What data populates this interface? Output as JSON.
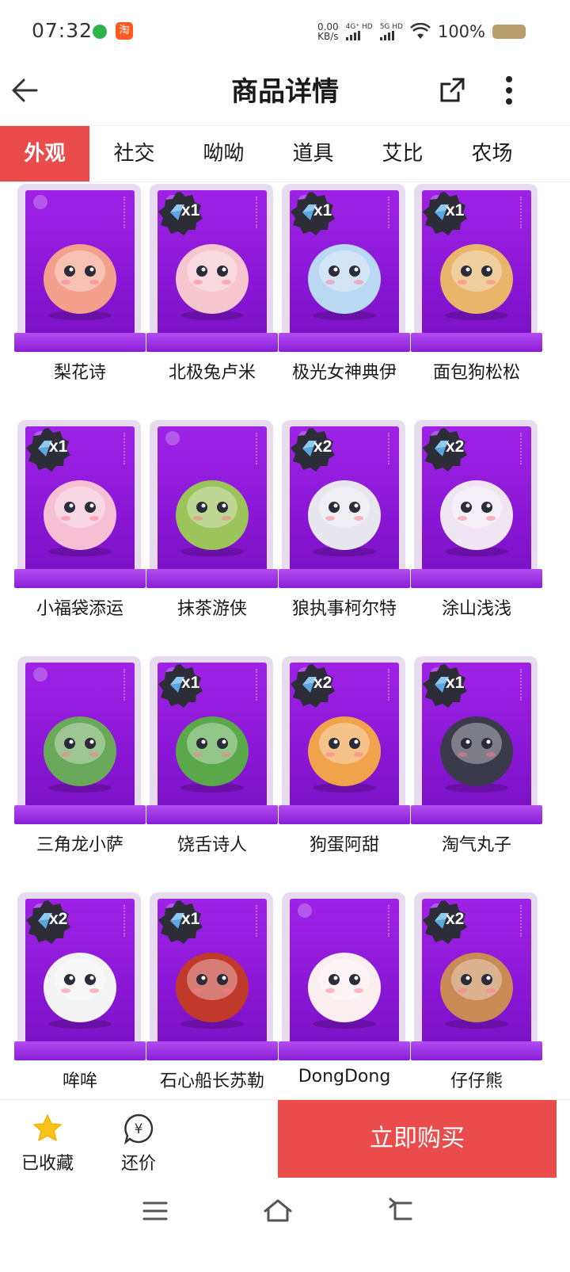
{
  "status_bar": {
    "time": "07:32",
    "net_speed_value": "0.00",
    "net_speed_unit": "KB/s",
    "sim1_label": "4G⁺ HD",
    "sim2_label": "5G HD",
    "battery_pct": "100%",
    "app_icon_text": "淘"
  },
  "nav": {
    "title": "商品详情",
    "back_icon": "arrow-left-icon",
    "share_icon": "share-icon",
    "more_icon": "more-vertical-icon"
  },
  "tabs": [
    {
      "label": "外观",
      "active": true
    },
    {
      "label": "社交",
      "active": false
    },
    {
      "label": "呦呦",
      "active": false
    },
    {
      "label": "道具",
      "active": false
    },
    {
      "label": "艾比",
      "active": false
    },
    {
      "label": "农场",
      "active": false
    }
  ],
  "items": [
    {
      "name": "梨花诗",
      "badge": "",
      "color": "#f3a08c"
    },
    {
      "name": "北极兔卢米",
      "badge": "x1",
      "color": "#f6c6cf"
    },
    {
      "name": "极光女神典伊",
      "badge": "x1",
      "color": "#b9d8f3"
    },
    {
      "name": "面包狗松松",
      "badge": "x1",
      "color": "#e9b56a"
    },
    {
      "name": "小福袋添运",
      "badge": "x1",
      "color": "#f5c0d4"
    },
    {
      "name": "抹茶游侠",
      "badge": "",
      "color": "#9bc45a"
    },
    {
      "name": "狼执事柯尔特",
      "badge": "x2",
      "color": "#e8e6ee"
    },
    {
      "name": "涂山浅浅",
      "badge": "x2",
      "color": "#f0e6f3"
    },
    {
      "name": "三角龙小萨",
      "badge": "",
      "color": "#6aa85a"
    },
    {
      "name": "饶舌诗人",
      "badge": "x1",
      "color": "#5aa84a"
    },
    {
      "name": "狗蛋阿甜",
      "badge": "x2",
      "color": "#f0a34a"
    },
    {
      "name": "淘气丸子",
      "badge": "x1",
      "color": "#3a3a4a"
    },
    {
      "name": "哞哞",
      "badge": "x2",
      "color": "#f3f3f3"
    },
    {
      "name": "石心船长苏勒",
      "badge": "x1",
      "color": "#c0392b"
    },
    {
      "name": "DongDong",
      "badge": "",
      "color": "#fbeef0"
    },
    {
      "name": "仔仔熊",
      "badge": "x2",
      "color": "#c98a55"
    }
  ],
  "action_bar": {
    "favorite_label": "已收藏",
    "bargain_label": "还价",
    "bargain_symbol": "¥",
    "buy_label": "立即购买"
  },
  "colors": {
    "accent": "#ea4c4c",
    "box_purple": "#9e22e6",
    "star_yellow": "#f9c21a"
  }
}
